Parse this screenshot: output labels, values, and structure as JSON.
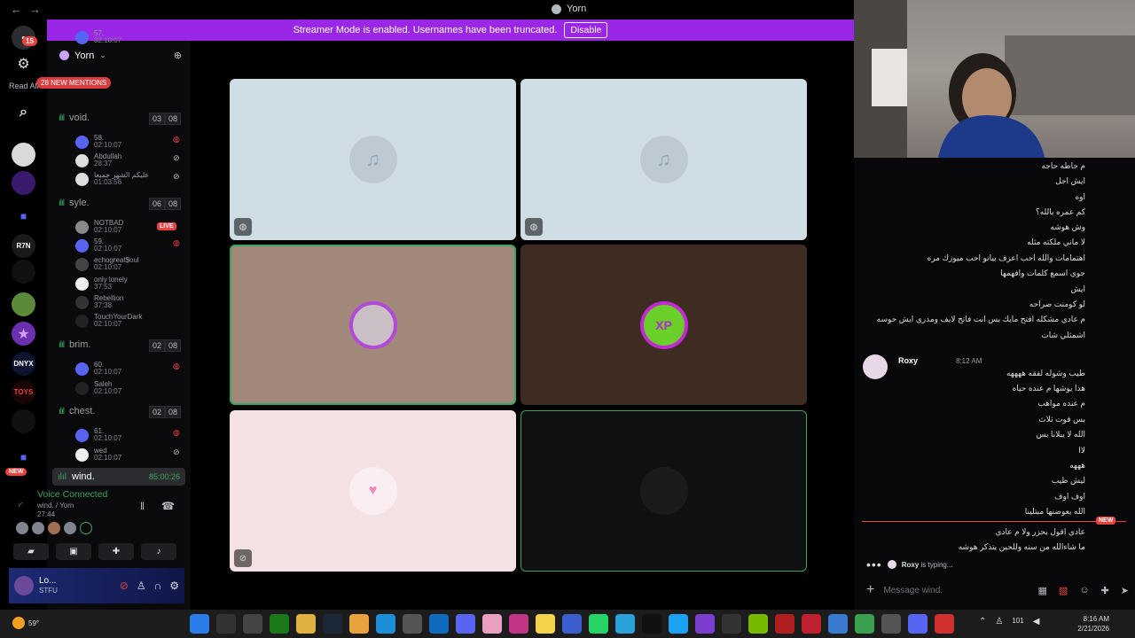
{
  "window": {
    "title": "Yorn",
    "nav_back": "←",
    "nav_forward": "→"
  },
  "banner": {
    "text": "Streamer Mode is enabled. Usernames have been truncated.",
    "button": "Disable"
  },
  "rail": {
    "dm_badge": "15",
    "read_all": "Read All",
    "new_badge": "NEW",
    "servers": [
      "R7N",
      "DNYX",
      "TOYS"
    ]
  },
  "server": {
    "name": "Yorn"
  },
  "mentions": "28 NEW MENTIONS",
  "voice_channels": [
    {
      "name": "void.",
      "count_a": "03",
      "count_b": "08"
    },
    {
      "name": "syle.",
      "count_a": "06",
      "count_b": "08"
    },
    {
      "name": "brim.",
      "count_a": "02",
      "count_b": "08"
    },
    {
      "name": "chest.",
      "count_a": "02",
      "count_b": "08"
    }
  ],
  "members": [
    {
      "name": "58.",
      "time": "02:10:07"
    },
    {
      "name": "Abdullah",
      "time": "28:37"
    },
    {
      "name": "عليكم الشهر جميعا",
      "time": "01:03:56"
    },
    {
      "name": "NOTBAD",
      "time": "02:10:07"
    },
    {
      "name": "59.",
      "time": "02:10:07"
    },
    {
      "name": "echogreat$oul",
      "time": "02:10:07"
    },
    {
      "name": "only lonely",
      "time": "37:53"
    },
    {
      "name": "Rebellion",
      "time": "37:38"
    },
    {
      "name": "TouchYourDark",
      "time": "02:10:07"
    },
    {
      "name": "60.",
      "time": "02:10:07"
    },
    {
      "name": "Saleh",
      "time": "02:10:07"
    },
    {
      "name": "61.",
      "time": "02:10:07"
    },
    {
      "name": "wed",
      "time": "02:10:07"
    }
  ],
  "top_partial": {
    "name": "57.",
    "time": "02:10:07"
  },
  "live_label": "LIVE",
  "active_channel": {
    "name": "wind.",
    "time": "85:00:26"
  },
  "voice": {
    "status": "Voice Connected",
    "location": "wind. / Yorn",
    "elapsed": "27:44"
  },
  "user": {
    "name": "Lo...",
    "status": "STFU"
  },
  "chat": {
    "messages_before": [
      "م حاطه حاجه",
      "ايش اجل",
      "اوه",
      "كم عمره بالله؟",
      "وش هوشه",
      "لا ماني ملكته مثله",
      "اهتمامات والله احب اعزف بيانو احب ميوزك مره",
      "جوي اسمع كلمات وافهمها",
      "ايش",
      "لو كومنت صراحه",
      "م عادي مشكله افتح مايك بس انت فاتح لايف ومدري ايش حوسه",
      "اشمثلي شات"
    ],
    "roxy": {
      "name": "Roxy",
      "time": "8:12 AM"
    },
    "roxy_messages": [
      "طيب وشوله لفقه ههههه",
      "هذا يوشها م عنده حياه",
      "م عنده مواهب",
      "بس فوت ثلاث",
      "الله لا يبلانا بس",
      "لاا",
      "هههه",
      "ليش طيب",
      "اوف اوف",
      "الله يعوضنها مبتلينا"
    ],
    "new_tag": "NEW",
    "messages_after": [
      "عادي اقول بحزر ولا م عادي",
      "ما شاءالله من سنه وللحين يتذكر هوشه"
    ],
    "typing_name": "Roxy",
    "typing_text": "is typing...",
    "composer_placeholder": "Message wind."
  },
  "taskbar": {
    "temp": "59°",
    "time": "8:16 AM",
    "date": "2/21/2026",
    "vol": "101"
  },
  "colors": {
    "accent": "#9b27e6",
    "voice_green": "#3ba55d",
    "danger": "#ed4245"
  }
}
